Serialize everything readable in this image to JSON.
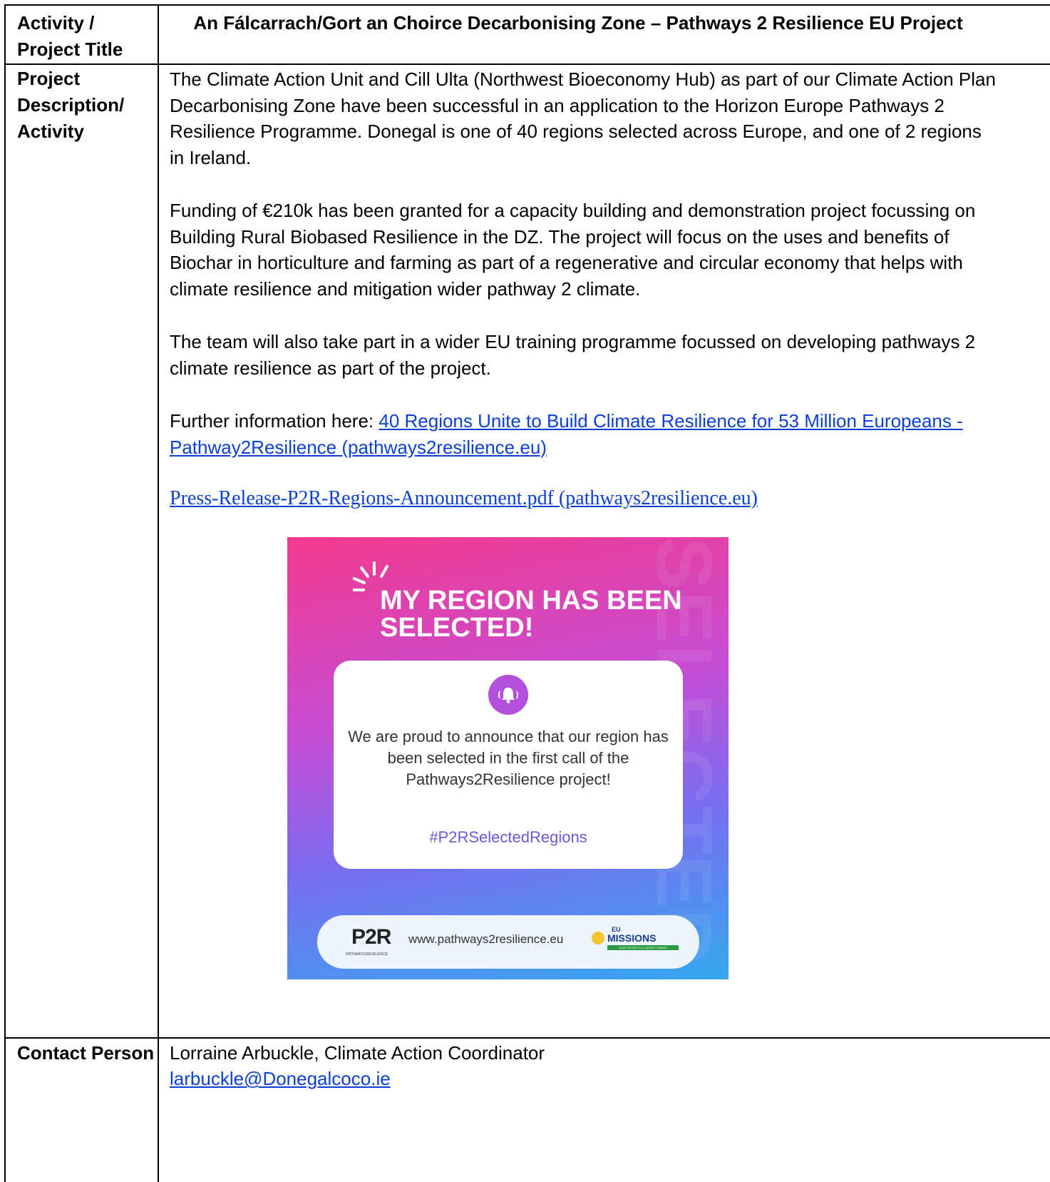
{
  "table": {
    "row1_label": "Activity / Project Title",
    "title": "An Fálcarrach/Gort an Choirce Decarbonising Zone – Pathways 2 Resilience EU Project",
    "row2_label": "Project Description/ Activity",
    "paragraphs": [
      "The Climate Action Unit and Cill Ulta (Northwest Bioeconomy Hub) as part of our Climate Action Plan Decarbonising Zone have been successful in an application to the Horizon Europe Pathways 2 Resilience Programme.   Donegal is one of 40 regions selected across Europe, and one of 2 regions in Ireland.",
      "Funding of €210k has been granted for a capacity building and demonstration project focussing on Building Rural Biobased Resilience in the DZ.  The project will focus on the uses and benefits of Biochar in horticulture and farming as part of a regenerative and circular economy that helps with climate resilience and mitigation wider pathway 2 climate.",
      "The team will also take part in a wider EU training programme focussed on developing pathways 2 climate resilience as part of the project."
    ],
    "further_info_prefix": "Further information here: ",
    "link1": "40 Regions Unite to Build Climate Resilience for 53 Million Europeans - Pathway2Resilience (pathways2resilience.eu)",
    "link2": "Press-Release-P2R-Regions-Announcement.pdf (pathways2resilience.eu)",
    "row3_label": "Contact Person",
    "contact_name": "Lorraine Arbuckle, Climate Action Coordinator",
    "contact_email": "larbuckle@Donegalcoco.ie"
  },
  "poster": {
    "watermark": "SELECTED",
    "headline": "MY REGION HAS BEEN SELECTED!",
    "announcement": "We are proud to announce that our region has been selected in the first call of the Pathways2Resilience project!",
    "hashtag": "#P2RSelectedRegions",
    "logo_text": "P2R",
    "logo_sub": "PATHWAYS2RESILIENCE",
    "url": "www.pathways2resilience.eu",
    "missions_eu": "EU",
    "missions_name": "MISSIONS",
    "missions_tag": "ADAPTATION TO CLIMATE CHANGE",
    "bell_icon": "bell-icon"
  }
}
